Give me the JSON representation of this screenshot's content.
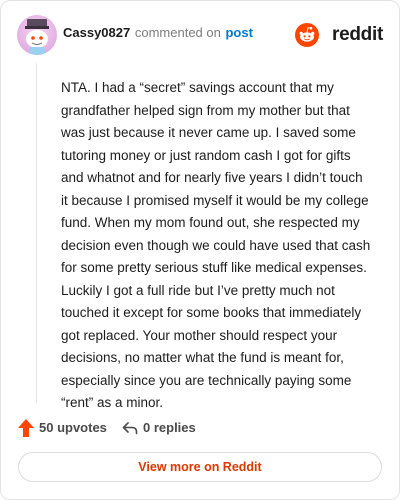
{
  "comment": {
    "username": "Cassy0827",
    "action_text": "commented on",
    "post_link": "post",
    "body": "NTA. I had a “secret” savings account that my grandfather helped sign from my mother but that was just because it never came up. I saved some tutoring money or just random cash I got for gifts and whatnot and for nearly five years I didn’t touch it because I promised myself it would be my college fund. When my mom found out, she respected my decision even though we could have used that cash for some pretty serious stuff like medical expenses. Luckily I got a full ride but I’ve pretty much not touched it except for some books that immediately got replaced. Your mother should respect your decisions, no matter what the fund is meant for, especially since you are technically paying some “rent” as a minor.",
    "upvotes": "50 upvotes",
    "replies": "0 replies"
  },
  "brand": {
    "name": "reddit",
    "logo_icon": "reddit-snoo-icon",
    "color": "#ff4500"
  },
  "view_more_label": "View more on Reddit",
  "colors": {
    "upvote": "#ff4500",
    "link": "#0079d3",
    "view_more": "#d93a00"
  }
}
